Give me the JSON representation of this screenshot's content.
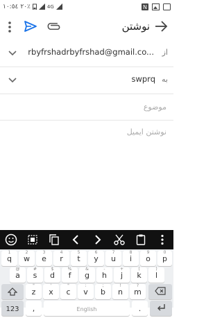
{
  "status": {
    "time": "١٠:٥٤",
    "battery": "٢٠٪",
    "network": "4G"
  },
  "appbar": {
    "title": "نوشتن"
  },
  "from": {
    "label": "از",
    "value": "rbyfrshadrbyfrshad@gmail.co..."
  },
  "to": {
    "label": "به",
    "value": "swprq"
  },
  "subject": {
    "placeholder": "موضوع"
  },
  "body": {
    "placeholder": "نوشتن ایمیل"
  },
  "keyboard": {
    "row1": [
      {
        "k": "q",
        "n": "1"
      },
      {
        "k": "w",
        "n": "2"
      },
      {
        "k": "e",
        "n": "3"
      },
      {
        "k": "r",
        "n": "4"
      },
      {
        "k": "t",
        "n": "5"
      },
      {
        "k": "y",
        "n": "6"
      },
      {
        "k": "u",
        "n": "7"
      },
      {
        "k": "i",
        "n": "8"
      },
      {
        "k": "o",
        "n": "9"
      },
      {
        "k": "p",
        "n": "0"
      }
    ],
    "row2": [
      {
        "k": "a",
        "n": "@"
      },
      {
        "k": "s",
        "n": "#"
      },
      {
        "k": "d",
        "n": "$"
      },
      {
        "k": "f",
        "n": "%"
      },
      {
        "k": "g",
        "n": "&"
      },
      {
        "k": "h",
        "n": "-"
      },
      {
        "k": "j",
        "n": "+"
      },
      {
        "k": "k",
        "n": "("
      },
      {
        "k": "l",
        "n": ")"
      }
    ],
    "row3": [
      {
        "k": "z",
        "n": "\""
      },
      {
        "k": "x",
        "n": "'"
      },
      {
        "k": "c",
        "n": "\""
      },
      {
        "k": "v",
        "n": ":"
      },
      {
        "k": "b",
        "n": ";"
      },
      {
        "k": "n",
        "n": "!"
      },
      {
        "k": "m",
        "n": "?"
      }
    ],
    "symbols_key": "123",
    "comma": ",",
    "space_label": "English",
    "period": "."
  }
}
